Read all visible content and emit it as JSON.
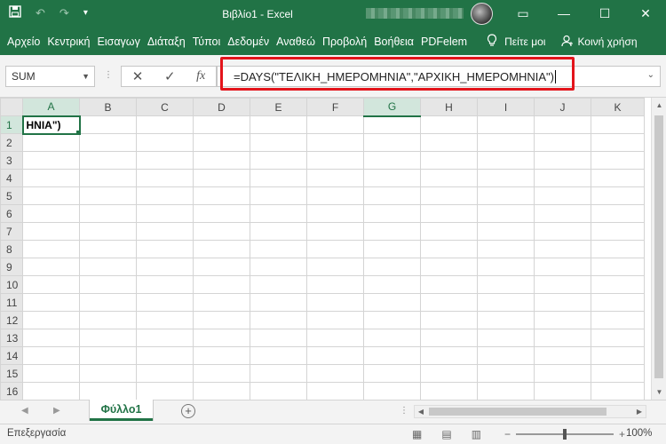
{
  "app": {
    "title": "Βιβλίο1  -  Excel",
    "accent": "#217346"
  },
  "quick_access": {
    "save_icon": "save-icon",
    "undo_icon": "undo-icon",
    "redo_icon": "redo-icon",
    "customize_icon": "customize-icon"
  },
  "window_controls": {
    "ribbon_display": "▭",
    "minimize": "—",
    "maximize": "☐",
    "close": "✕"
  },
  "ribbon": {
    "tabs": [
      "Αρχείο",
      "Κεντρική",
      "Εισαγωγ",
      "Διάταξη",
      "Τύποι",
      "Δεδομέν",
      "Αναθεώ",
      "Προβολή",
      "Βοήθεια",
      "PDFelem"
    ],
    "tell_me": "Πείτε μοι",
    "share": "Κοινή χρήση"
  },
  "formula_bar": {
    "name_box": "SUM",
    "cancel": "✕",
    "enter": "✓",
    "fx": "fx",
    "formula": "=DAYS(\"ΤΕΛΙΚΗ_ΗΜΕΡΟΜΗΝΙΑ\",\"ΑΡΧΙΚΗ_ΗΜΕΡΟΜΗΝΙΑ\")"
  },
  "grid": {
    "columns": [
      "A",
      "B",
      "C",
      "D",
      "E",
      "F",
      "G",
      "H",
      "I",
      "J",
      "K"
    ],
    "rows": [
      "1",
      "2",
      "3",
      "4",
      "5",
      "6",
      "7",
      "8",
      "9",
      "10",
      "11",
      "12",
      "13",
      "14",
      "15",
      "16"
    ],
    "active_cell_text": "ΗΝΙΑ\")",
    "selected_column": "G"
  },
  "sheets": {
    "tabs": [
      "Φύλλο1"
    ],
    "add": "+"
  },
  "status": {
    "mode": "Επεξεργασία",
    "zoom_minus": "−",
    "zoom_plus": "+",
    "zoom": "100%"
  }
}
